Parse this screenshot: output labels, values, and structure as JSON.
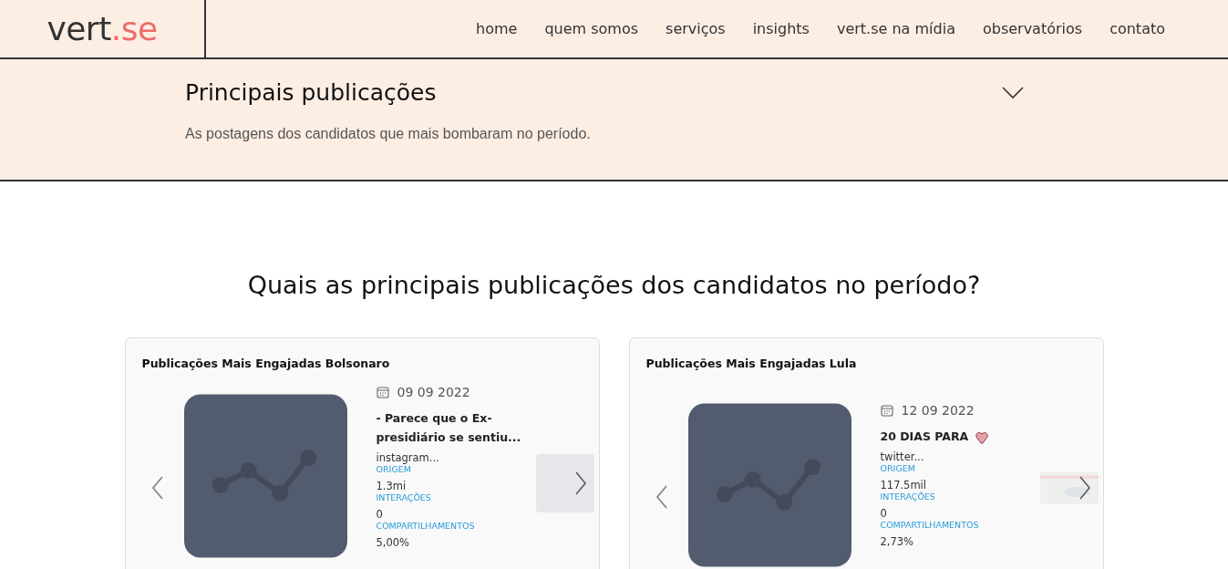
{
  "logo": {
    "main": "vert",
    "accent": ".se"
  },
  "nav": [
    {
      "label": "home"
    },
    {
      "label": "quem somos"
    },
    {
      "label": "serviços"
    },
    {
      "label": "insights"
    },
    {
      "label": "vert.se na mídia"
    },
    {
      "label": "observatórios"
    },
    {
      "label": "contato"
    }
  ],
  "accordion": {
    "title": "Principais publicações",
    "expanded": true,
    "description": "As postagens dos candidatos que mais bombaram no período."
  },
  "heading": "Quais as principais publicações dos candidatos no período?",
  "cards": [
    {
      "title": "Publicações Mais Engajadas Bolsonaro",
      "date": "09 09 2022",
      "post_title": "- Parece que o Ex-presidiário se sentiu...",
      "stats": [
        {
          "value": "instagram...",
          "label": "ORIGEM"
        },
        {
          "value": "1.3mi",
          "label": "INTERAÇÕES"
        },
        {
          "value": "0",
          "label": "COMPARTILHAMENTOS"
        },
        {
          "value": "5,00%"
        }
      ]
    },
    {
      "title": "Publicações Mais Engajadas Lula",
      "date": "12 09 2022",
      "post_title": "20 DIAS PARA",
      "stats": [
        {
          "value": "twitter...",
          "label": "ORIGEM"
        },
        {
          "value": "117.5mil",
          "label": "INTERAÇÕES"
        },
        {
          "value": "0",
          "label": "COMPARTILHAMENTOS"
        },
        {
          "value": "2,73%"
        }
      ]
    }
  ]
}
